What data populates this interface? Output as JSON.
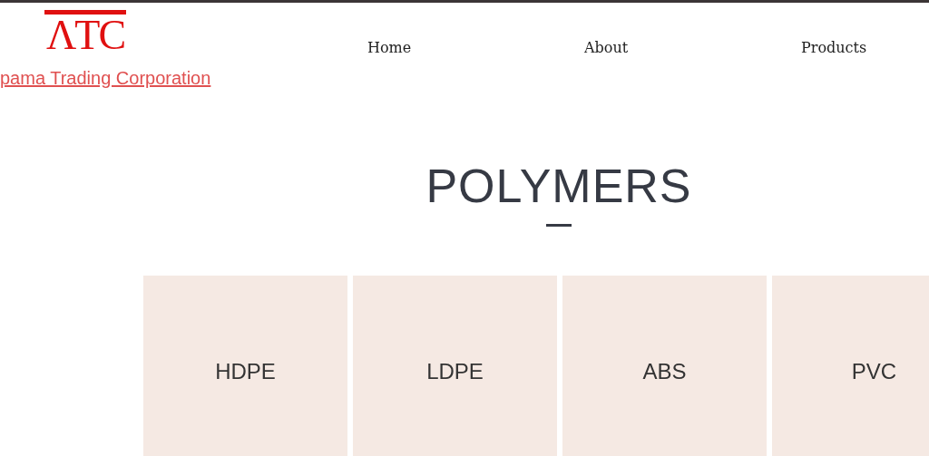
{
  "header": {
    "logo": "ΛTC",
    "company_link": "pama Trading Corporation"
  },
  "nav": [
    {
      "label": "Home"
    },
    {
      "label": "About"
    },
    {
      "label": "Products"
    }
  ],
  "section": {
    "title": "POLYMERS"
  },
  "tiles": [
    {
      "label": "HDPE"
    },
    {
      "label": "LDPE"
    },
    {
      "label": "ABS"
    },
    {
      "label": "PVC"
    }
  ]
}
